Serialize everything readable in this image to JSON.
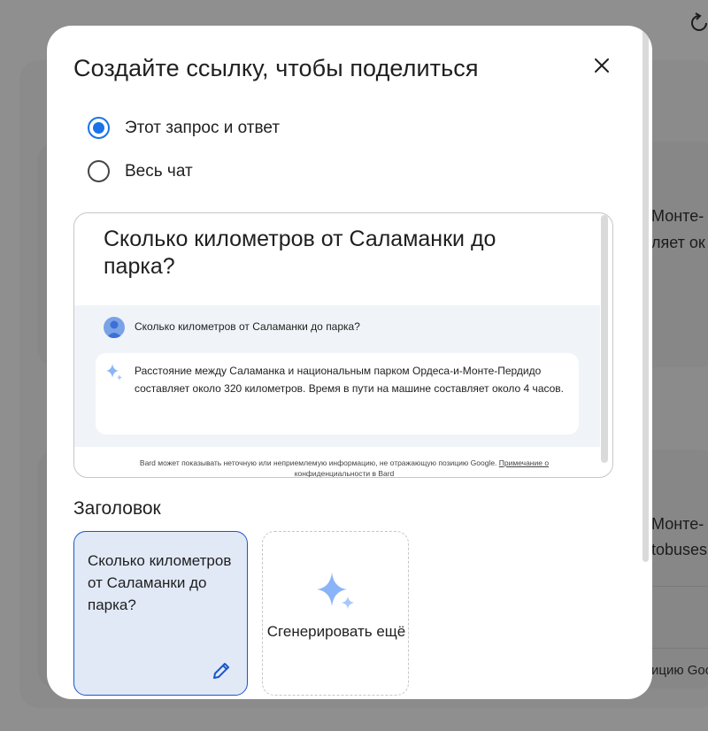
{
  "modal": {
    "title": "Создайте ссылку, чтобы поделиться",
    "close_icon": "close-icon",
    "options": [
      {
        "label": "Этот запрос и ответ",
        "checked": true
      },
      {
        "label": "Весь чат",
        "checked": false
      }
    ]
  },
  "preview": {
    "title": "Сколько километров от Саламанки до парка?",
    "user_question": "Сколько километров от Саламанки до парка?",
    "answer": "Расстояние между Саламанка и национальным парком Ордеса-и-Монте-Пердидо составляет около 320 километров. Время в пути на машине составляет около 4 часов.",
    "disclaimer_text": "Bard может показывать неточную или неприемлемую информацию, не отражающую позицию Google.",
    "disclaimer_link": "Примечание о конфиденциальности в Bard"
  },
  "heading_section": {
    "label": "Заголовок",
    "selected_title": "Сколько километров от Саламанки до парка?",
    "generate_label": "Сгенерировать ещё",
    "edit_icon": "pencil-icon",
    "generate_icon": "sparkle-icon"
  },
  "background": {
    "snippets": [
      "Монте-",
      "ляет ок",
      "Монте-",
      "tobuses",
      "ицию Goo"
    ]
  },
  "colors": {
    "accent": "#1a73e8",
    "selected_card_bg": "#e1e9f7",
    "selected_card_border": "#1a56c8",
    "sparkle": "#8ab4f8",
    "overlay": "#8f8f8f"
  }
}
